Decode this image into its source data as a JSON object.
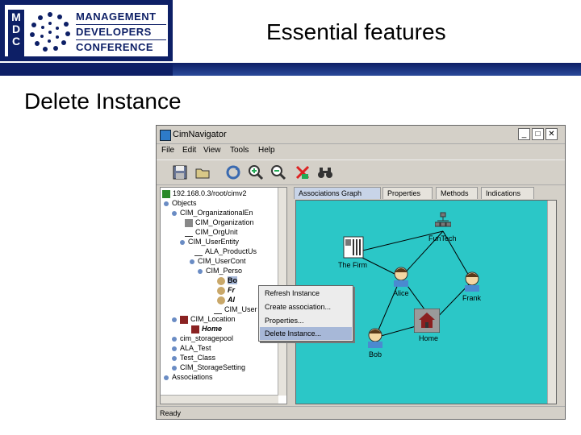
{
  "slide": {
    "title": "Essential features",
    "subtitle": "Delete Instance"
  },
  "logo": {
    "letters": [
      "M",
      "D",
      "C"
    ],
    "words": [
      "MANAGEMENT",
      "DEVELOPERS",
      "CONFERENCE"
    ]
  },
  "window": {
    "title": "CimNavigator",
    "controls": [
      "_",
      "□",
      "✕"
    ]
  },
  "menu": [
    "File",
    "Edit",
    "View",
    "Tools",
    "Help"
  ],
  "toolbar_icons": [
    "save-icon",
    "open-folder-icon",
    "refresh-icon",
    "zoom-in-icon",
    "zoom-out-icon",
    "delete-icon",
    "binoculars-icon"
  ],
  "tree": {
    "items": [
      {
        "label": "192.168.0.3/root/cimv2"
      },
      {
        "label": "Objects"
      },
      {
        "label": "CIM_OrganizationalEn"
      },
      {
        "label": "CIM_Organization"
      },
      {
        "label": "CIM_OrgUnit"
      },
      {
        "label": "CIM_UserEntity"
      },
      {
        "label": "ALA_ProductUs"
      },
      {
        "label": "CIM_UserCont"
      },
      {
        "label": "CIM_Perso"
      },
      {
        "label": "Bo"
      },
      {
        "label": "Fr"
      },
      {
        "label": "Al"
      },
      {
        "label": "CIM_User"
      },
      {
        "label": "CIM_Location"
      },
      {
        "label": "Home"
      },
      {
        "label": "cim_storagepool"
      },
      {
        "label": "ALA_Test"
      },
      {
        "label": "Test_Class"
      },
      {
        "label": "CIM_StorageSetting"
      },
      {
        "label": "Associations"
      }
    ]
  },
  "tabs": [
    "Associations Graph",
    "Properties",
    "Methods",
    "Indications"
  ],
  "graph": {
    "background": "#2bc7c7",
    "nodes": [
      {
        "label": "FunTech"
      },
      {
        "label": "The Firm"
      },
      {
        "label": "Alice"
      },
      {
        "label": "Frank"
      },
      {
        "label": "Home"
      },
      {
        "label": "Bob"
      }
    ]
  },
  "context_menu": {
    "items": [
      "Refresh Instance",
      "Create association...",
      "Properties...",
      "Delete Instance..."
    ],
    "highlighted": "Delete Instance..."
  },
  "status": "Ready"
}
